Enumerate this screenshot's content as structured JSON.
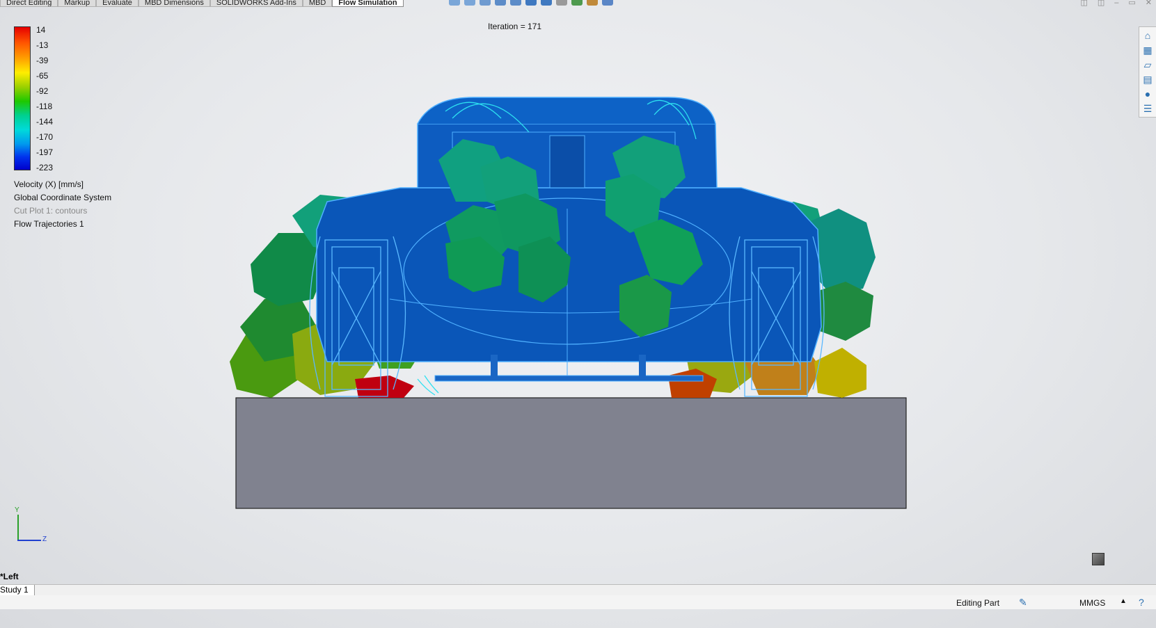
{
  "tabs": [
    "Direct Editing",
    "Markup",
    "Evaluate",
    "MBD Dimensions",
    "SOLIDWORKS Add-Ins",
    "MBD",
    "Flow Simulation"
  ],
  "active_tab": "Flow Simulation",
  "iteration": "Iteration = 171",
  "legend": {
    "values": [
      "14",
      "-13",
      "-39",
      "-65",
      "-92",
      "-118",
      "-144",
      "-170",
      "-197",
      "-223"
    ],
    "parameter": "Velocity (X) [mm/s]",
    "coordinate_system": "Global Coordinate System",
    "cut_plot": "Cut Plot 1: contours",
    "trajectories": "Flow Trajectories 1"
  },
  "triad": {
    "y": "Y",
    "z": "Z"
  },
  "view_label": "*Left",
  "study_tab": "Study 1",
  "status": {
    "editing": "Editing Part",
    "units": "MMGS",
    "units_arrow": "▲"
  },
  "icons": {
    "right_toolbar": [
      "home-icon",
      "3d-view-icon",
      "folder-icon",
      "view-palette-icon",
      "appearance-icon",
      "custom-properties-icon"
    ],
    "status": [
      "rebuild-icon",
      "help-icon"
    ]
  },
  "colors": {
    "body_blue": "#0a56b8",
    "wire": "#4fb0ff",
    "ground": "#80828f",
    "accent": "#2a6fb0"
  }
}
